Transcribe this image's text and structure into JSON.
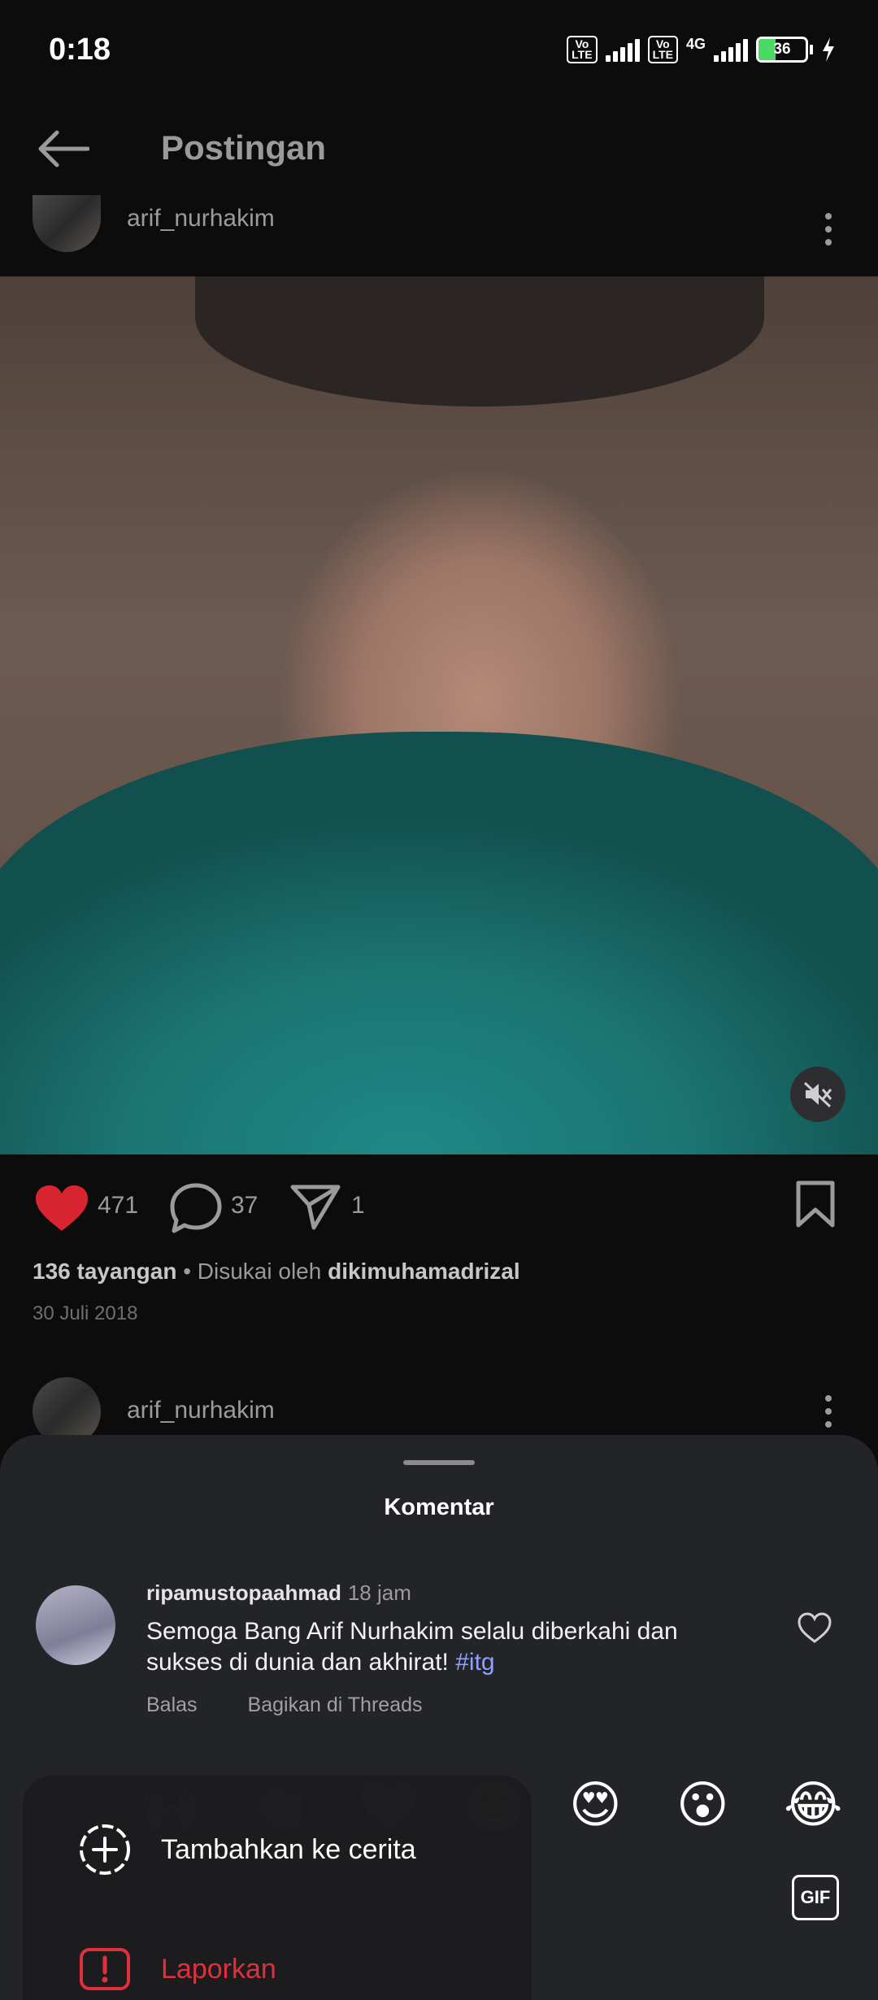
{
  "status_bar": {
    "time": "0:18",
    "volte": "Vo\nLTE",
    "network": "4G",
    "battery": "36"
  },
  "header": {
    "title": "Postingan"
  },
  "post": {
    "username": "arif_nurhakim",
    "likes": "471",
    "comments": "37",
    "shares": "1",
    "views": "136 tayangan",
    "liked_by_prefix": " • Disukai oleh ",
    "liked_by_user": "dikimuhamadrizal",
    "date": "30 Juli 2018"
  },
  "next_post": {
    "username": "arif_nurhakim"
  },
  "comments_sheet": {
    "title": "Komentar",
    "comment": {
      "username": "ripamustopaahmad",
      "time": "18 jam",
      "text": "Semoga Bang Arif Nurhakim selalu diberkahi dan sukses di dunia dan akhirat! ",
      "hashtag": "#itg",
      "reply": "Balas",
      "share_threads": "Bagikan di Threads"
    },
    "quick_emojis": [
      "😍",
      "😮",
      "😂"
    ],
    "gif_label": "GIF"
  },
  "menu": {
    "add_to_story": "Tambahkan ke cerita",
    "report": "Laporkan"
  },
  "colors": {
    "like_red": "#d9252f",
    "report_red": "#e0303b",
    "hashtag": "#8fa0ff"
  }
}
